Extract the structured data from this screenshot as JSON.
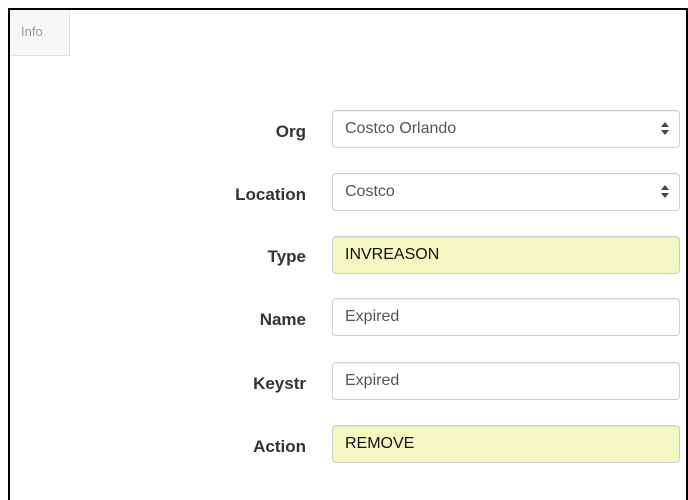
{
  "tab": {
    "label": "Info"
  },
  "form": {
    "org": {
      "label": "Org",
      "value": "Costco Orlando"
    },
    "location": {
      "label": "Location",
      "value": "Costco"
    },
    "type": {
      "label": "Type",
      "value": "INVREASON"
    },
    "name": {
      "label": "Name",
      "value": "Expired"
    },
    "keystr": {
      "label": "Keystr",
      "value": "Expired"
    },
    "action": {
      "label": "Action",
      "value": "REMOVE"
    }
  },
  "colors": {
    "highlight": "#f3f7c2",
    "border": "#000000"
  }
}
